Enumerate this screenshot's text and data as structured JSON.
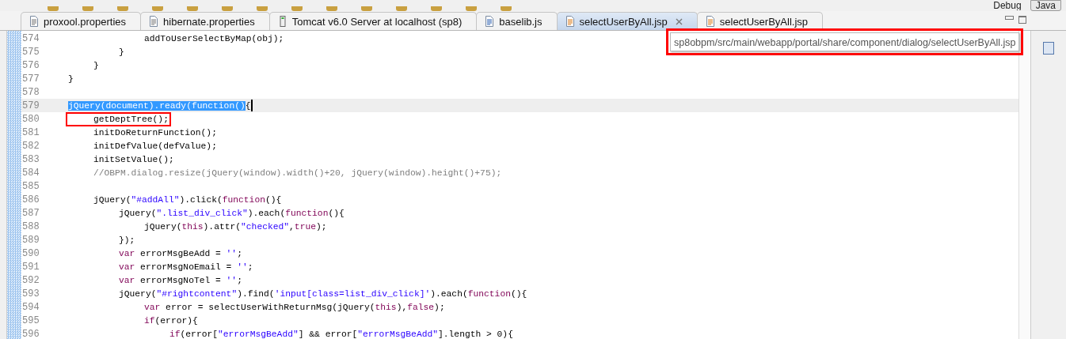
{
  "toolbar": {
    "perspectives": [
      {
        "label": "Debug",
        "selected": false
      },
      {
        "label": "Java",
        "selected": true
      }
    ]
  },
  "tabs": [
    {
      "label": "proxool.properties",
      "kind": "properties",
      "selected": false
    },
    {
      "label": "hibernate.properties",
      "kind": "properties",
      "selected": false
    },
    {
      "label": "Tomcat v6.0 Server at localhost (sp8)",
      "kind": "server",
      "selected": false
    },
    {
      "label": "baselib.js",
      "kind": "script",
      "selected": false
    },
    {
      "label": "selectUserByAll.jsp",
      "kind": "jsp",
      "selected": true
    },
    {
      "label": "selectUserByAll.jsp",
      "kind": "jsp",
      "selected": false
    }
  ],
  "tooltip": {
    "text": "sp8obpm/src/main/webapp/portal/share/component/dialog/selectUserByAll.jsp",
    "annotated": true
  },
  "editor": {
    "lines": [
      {
        "number": "574",
        "current": false,
        "segments": [
          {
            "kind": "plain",
            "text": "\t\t\taddToUserSelectByMap(obj);"
          }
        ]
      },
      {
        "number": "575",
        "current": false,
        "segments": [
          {
            "kind": "plain",
            "text": "\t\t}"
          }
        ]
      },
      {
        "number": "576",
        "current": false,
        "segments": [
          {
            "kind": "plain",
            "text": "\t}"
          }
        ]
      },
      {
        "number": "577",
        "current": false,
        "segments": [
          {
            "kind": "plain",
            "text": "}"
          }
        ]
      },
      {
        "number": "578",
        "current": false
      },
      {
        "number": "579",
        "current": true,
        "segments": [
          {
            "kind": "selected",
            "text": "jQuery(document).ready(function()"
          },
          {
            "kind": "plain",
            "text": "{"
          }
        ]
      },
      {
        "number": "580",
        "current": false,
        "boxed": true,
        "segments": [
          {
            "kind": "plain",
            "text": "\tgetDeptTree();"
          }
        ]
      },
      {
        "number": "581",
        "current": false,
        "segments": [
          {
            "kind": "plain",
            "text": "\tinitDoReturnFunction();"
          }
        ]
      },
      {
        "number": "582",
        "current": false,
        "segments": [
          {
            "kind": "plain",
            "text": "\tinitDefValue(defValue);"
          }
        ]
      },
      {
        "number": "583",
        "current": false,
        "segments": [
          {
            "kind": "plain",
            "text": "\tinitSetValue();"
          }
        ]
      },
      {
        "number": "584",
        "current": false,
        "segments": [
          {
            "kind": "comment",
            "text": "\t//OBPM.dialog.resize(jQuery(window).width()+20, jQuery(window).height()+75);"
          }
        ]
      },
      {
        "number": "585",
        "current": false
      },
      {
        "number": "586",
        "current": false,
        "segments": [
          {
            "kind": "plain",
            "text": "\tjQuery("
          },
          {
            "kind": "string",
            "text": "\"#addAll\""
          },
          {
            "kind": "plain",
            "text": ").click("
          },
          {
            "kind": "keyword",
            "text": "function"
          },
          {
            "kind": "plain",
            "text": "(){"
          }
        ]
      },
      {
        "number": "587",
        "current": false,
        "segments": [
          {
            "kind": "plain",
            "text": "\t\tjQuery("
          },
          {
            "kind": "string",
            "text": "\".list_div_click\""
          },
          {
            "kind": "plain",
            "text": ").each("
          },
          {
            "kind": "keyword",
            "text": "function"
          },
          {
            "kind": "plain",
            "text": "(){"
          }
        ]
      },
      {
        "number": "588",
        "current": false,
        "segments": [
          {
            "kind": "plain",
            "text": "\t\t\tjQuery("
          },
          {
            "kind": "keyword",
            "text": "this"
          },
          {
            "kind": "plain",
            "text": ").attr("
          },
          {
            "kind": "string",
            "text": "\"checked\""
          },
          {
            "kind": "plain",
            "text": ","
          },
          {
            "kind": "keyword",
            "text": "true"
          },
          {
            "kind": "plain",
            "text": ");"
          }
        ]
      },
      {
        "number": "589",
        "current": false,
        "segments": [
          {
            "kind": "plain",
            "text": "\t\t});"
          }
        ]
      },
      {
        "number": "590",
        "current": false,
        "segments": [
          {
            "kind": "keyword",
            "text": "\t\tvar"
          },
          {
            "kind": "plain",
            "text": " errorMsgBeAdd = "
          },
          {
            "kind": "string",
            "text": "''"
          },
          {
            "kind": "plain",
            "text": ";"
          }
        ]
      },
      {
        "number": "591",
        "current": false,
        "segments": [
          {
            "kind": "keyword",
            "text": "\t\tvar"
          },
          {
            "kind": "plain",
            "text": " errorMsgNoEmail = "
          },
          {
            "kind": "string",
            "text": "''"
          },
          {
            "kind": "plain",
            "text": ";"
          }
        ]
      },
      {
        "number": "592",
        "current": false,
        "segments": [
          {
            "kind": "keyword",
            "text": "\t\tvar"
          },
          {
            "kind": "plain",
            "text": " errorMsgNoTel = "
          },
          {
            "kind": "string",
            "text": "''"
          },
          {
            "kind": "plain",
            "text": ";"
          }
        ]
      },
      {
        "number": "593",
        "current": false,
        "segments": [
          {
            "kind": "plain",
            "text": "\t\tjQuery("
          },
          {
            "kind": "string",
            "text": "\"#rightcontent\""
          },
          {
            "kind": "plain",
            "text": ").find("
          },
          {
            "kind": "string",
            "text": "'input[class=list_div_click]'"
          },
          {
            "kind": "plain",
            "text": ").each("
          },
          {
            "kind": "keyword",
            "text": "function"
          },
          {
            "kind": "plain",
            "text": "(){"
          }
        ]
      },
      {
        "number": "594",
        "current": false,
        "segments": [
          {
            "kind": "keyword",
            "text": "\t\t\tvar"
          },
          {
            "kind": "plain",
            "text": " error = selectUserWithReturnMsg(jQuery("
          },
          {
            "kind": "keyword",
            "text": "this"
          },
          {
            "kind": "plain",
            "text": "),"
          },
          {
            "kind": "keyword",
            "text": "false"
          },
          {
            "kind": "plain",
            "text": ");"
          }
        ]
      },
      {
        "number": "595",
        "current": false,
        "segments": [
          {
            "kind": "keyword",
            "text": "\t\t\tif"
          },
          {
            "kind": "plain",
            "text": "(error){"
          }
        ]
      },
      {
        "number": "596",
        "current": false,
        "segments": [
          {
            "kind": "keyword",
            "text": "\t\t\t\tif"
          },
          {
            "kind": "plain",
            "text": "(error["
          },
          {
            "kind": "string",
            "text": "\"errorMsgBeAdd\""
          },
          {
            "kind": "plain",
            "text": "] && error["
          },
          {
            "kind": "string",
            "text": "\"errorMsgBeAdd\""
          },
          {
            "kind": "plain",
            "text": "].length > 0){"
          }
        ]
      }
    ]
  }
}
